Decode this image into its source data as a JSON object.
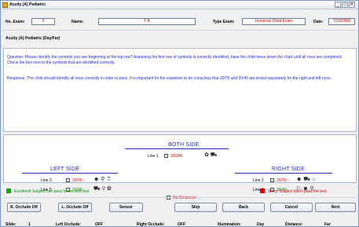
{
  "window": {
    "title": "Acuity (A) Pediatric",
    "controls": [
      "_",
      "□",
      "✕"
    ]
  },
  "header": {
    "exam_no_label": "No. Exam:",
    "exam_no_value": "9",
    "name_label": "Name:",
    "name_value": "T A",
    "type_label": "Type Exam:",
    "type_value": "Universal Child Exam",
    "date_label": "Date:",
    "date_value": "7/20/2006"
  },
  "subtitle": "Acuity (A) Pediatric (Day/Far)",
  "question": "Question: Please identify the symbols you see beginning at the top row? Assuming the first row of symbols is correctly identified, have the child move down the chart until all rows are completed. Check the box next to the symbols that are identified correctly.",
  "response": "Response: The child should identify all rows correctly in order to pass. It is important for the examiner to be conscious that 20/70 and 20/40 are tested separately for the right and left eyes.",
  "both_side": {
    "heading": "BOTH SIDE",
    "line_label": "Line 1",
    "acuity": "20/200",
    "symbols": "✿ ⛟"
  },
  "left_side": {
    "heading": "LEFT SIDE",
    "lines": [
      {
        "label": "Line 3",
        "acuity": "20/70 -",
        "symbols": "☻ ⚲ ♖"
      },
      {
        "label": "Line 5",
        "acuity": "20/40 -",
        "symbols": "⛟ ⚲ ✿"
      }
    ]
  },
  "right_side": {
    "heading": "RIGHT SIDE",
    "lines": [
      {
        "label": "Line 2",
        "acuity": "20/70 -",
        "symbols": "☻ ⛟ ⌂"
      },
      {
        "label": "Line 4",
        "acuity": "20/40 -",
        "symbols": "⚐ ☻ ⚲"
      }
    ]
  },
  "no_response": "No Response",
  "status": {
    "pass_text": "Excellent! Subject can pass to the next test",
    "fail_text": "Sorry! Subject didn't pass the test."
  },
  "buttons": {
    "r_occlude": "R. Occlude Off",
    "l_occlude": "L. Occlude Off",
    "sensor": "Sensor",
    "skip": "Skip",
    "back": "Back",
    "cancel": "Cancel",
    "next": "Next"
  },
  "statusbar": {
    "slide_label": "Slide:",
    "slide_value": "1",
    "left_label": "Left Occlude:",
    "left_value": "OFF",
    "right_label": "Right Occlude:",
    "right_value": "OFF",
    "illum_label": "Illumination:",
    "illum_value": "Day",
    "distance_label": "Distance:",
    "distance_value": "Far"
  },
  "colors": {
    "accent_blue": "#1e2bd6",
    "red": "#d00000",
    "green": "#0a8a0a",
    "pass_square": "#15a015",
    "fail_square": "#e00000"
  }
}
